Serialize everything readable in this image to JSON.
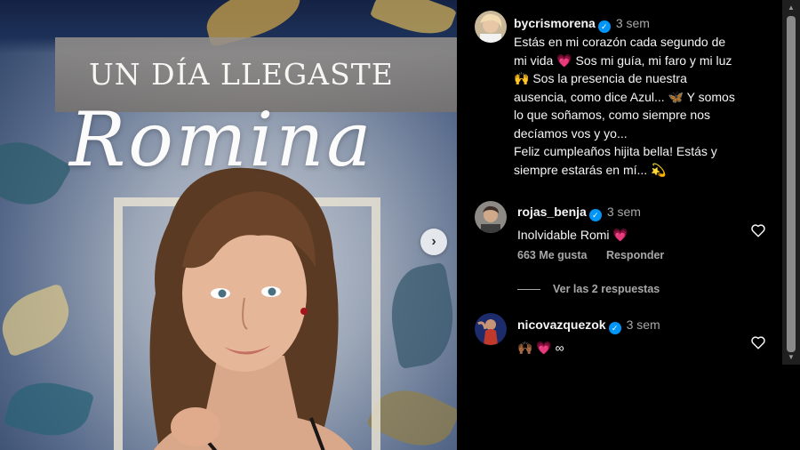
{
  "media": {
    "banner_title": "UN DÍA LLEGASTE",
    "script_name": "Romina",
    "next_glyph": "›"
  },
  "caption": {
    "username": "bycrismorena",
    "time": "3 sem",
    "lines": [
      "Estás en mi corazón cada segundo de",
      "mi vida 💗  Sos mi guía, mi faro y mi luz",
      "🙌 Sos la presencia de nuestra",
      "ausencia, como dice Azul... 🦋 Y somos",
      "lo que soñamos, como siempre nos",
      "decíamos vos y yo...",
      "Feliz cumpleaños hijita bella! Estás y",
      "siempre estarás en mí... 💫"
    ]
  },
  "comments": [
    {
      "username": "rojas_benja",
      "time": "3 sem",
      "text": "Inolvidable Romi 💗",
      "likes": "663 Me gusta",
      "reply_label": "Responder",
      "view_replies": "Ver las 2 respuestas"
    },
    {
      "username": "nicovazquezok",
      "time": "3 sem",
      "text": "🙌🏾 💗 ∞"
    }
  ],
  "icons": {
    "verified": "verified-badge-icon",
    "heart": "heart-outline-icon",
    "next": "chevron-right-icon"
  },
  "colors": {
    "background": "#000000",
    "secondary_text": "#a8a8a8",
    "verified_blue": "#0095f6",
    "heart_pink": "#ff3d7a"
  }
}
